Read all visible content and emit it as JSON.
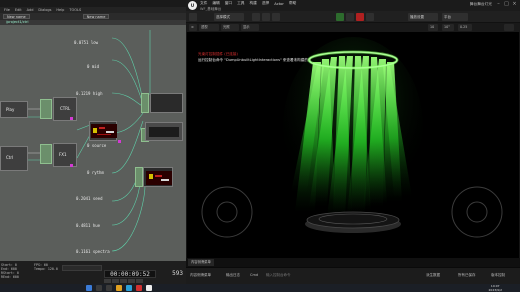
{
  "td": {
    "menu": [
      "File",
      "Edit",
      "Add",
      "Dialogs",
      "Help",
      "TOOLS"
    ],
    "tabs": [
      "New name",
      "New name"
    ],
    "path": "/project1/ctrl",
    "values": [
      "0.0751 low",
      "0 mid",
      "0.1219 high",
      "0 source",
      "0 rythm",
      "0.2041 seed",
      "0.4811 hue",
      "0.1161 spectra"
    ],
    "node_labels": [
      "Play",
      "Ctrl",
      "CTRL",
      "FX1"
    ],
    "stats": [
      "Start: 0",
      "End: 600",
      "RStart: 0",
      "REnd: 600",
      "FPS: 60",
      "Tempo: 120.0"
    ],
    "time": "00:00:09:52",
    "frame": "593"
  },
  "ue": {
    "logo": "U",
    "menu": [
      "文件",
      "编辑",
      "窗口",
      "工具",
      "构建",
      "选择",
      "Actor",
      "帮助"
    ],
    "project": "WF_基础舞台",
    "app_title": "舞台舞台灯光",
    "toolbar": {
      "mode": "选择模式",
      "play_label": "播放设置",
      "platform": "平台"
    },
    "vpbar": {
      "perspective": "透视",
      "lit": "光照",
      "show": "显示",
      "grid": "10",
      "angle": "10°",
      "scale": "0.25"
    },
    "message": {
      "line1": "光束灯控制插件 (已连接)",
      "line2": "运行控制台命令 \"DumpUnbuiltLightInteractions\" 来查看未构建的灯"
    },
    "panel_tab": "内容侧滑菜单",
    "statusbar": {
      "content": "内容侧滑菜单",
      "output": "输出日志",
      "cmd": "Cmd",
      "cmd_hint": "输入控制台命令",
      "derived": "派生数据",
      "source": "所有已保存",
      "revision": "版本控制"
    }
  },
  "taskbar": {
    "time": "19:07",
    "date": "2023/9/2"
  },
  "colors": {
    "beam": "#3cff3c",
    "td_bg": "#5b5e5b",
    "ue_bg": "#151515"
  }
}
